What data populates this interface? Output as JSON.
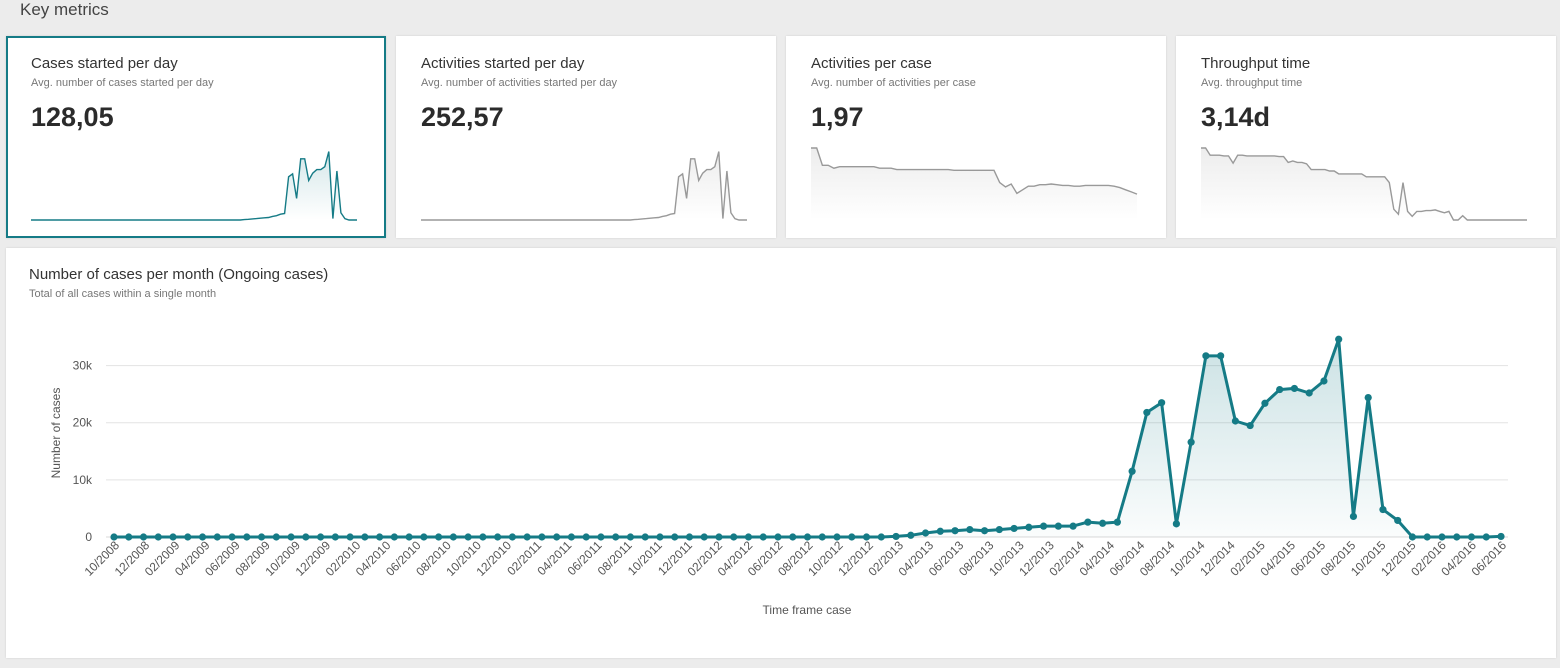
{
  "page": {
    "title": "Key metrics"
  },
  "cards": [
    {
      "title": "Cases started per day",
      "subtitle": "Avg. number of cases started per day",
      "value": "128,05",
      "selected": true,
      "color": "#157b86"
    },
    {
      "title": "Activities started per day",
      "subtitle": "Avg. number of activities started per day",
      "value": "252,57",
      "selected": false,
      "color": "#999999"
    },
    {
      "title": "Activities per case",
      "subtitle": "Avg. number of activities per case",
      "value": "1,97",
      "selected": false,
      "color": "#999999"
    },
    {
      "title": "Throughput time",
      "subtitle": "Avg. throughput time",
      "value": "3,14d",
      "selected": false,
      "color": "#999999"
    }
  ],
  "sparklines": [
    [
      0,
      0,
      0,
      0,
      0,
      0,
      0,
      0,
      0,
      0,
      0,
      0,
      0,
      0,
      0,
      0,
      0,
      0,
      0,
      0,
      0,
      0,
      0,
      0,
      0,
      0,
      0,
      0,
      0,
      0,
      0,
      0,
      0,
      0,
      0,
      0,
      0,
      0,
      0,
      0,
      0,
      0,
      0,
      0,
      0,
      0,
      0,
      0,
      0,
      0,
      0,
      0,
      0,
      0.5,
      1,
      1.5,
      2,
      2.5,
      3,
      3.5,
      5,
      6,
      8,
      9,
      60,
      64,
      30,
      85,
      85,
      55,
      65,
      70,
      70,
      74,
      95,
      2,
      68,
      10,
      2,
      0,
      0,
      0
    ],
    [
      0,
      0,
      0,
      0,
      0,
      0,
      0,
      0,
      0,
      0,
      0,
      0,
      0,
      0,
      0,
      0,
      0,
      0,
      0,
      0,
      0,
      0,
      0,
      0,
      0,
      0,
      0,
      0,
      0,
      0,
      0,
      0,
      0,
      0,
      0,
      0,
      0,
      0,
      0,
      0,
      0,
      0,
      0,
      0,
      0,
      0,
      0,
      0,
      0,
      0,
      0,
      0,
      0,
      0.5,
      1,
      1.5,
      2,
      2.5,
      3,
      3.5,
      5,
      6,
      8,
      9,
      60,
      64,
      30,
      85,
      85,
      55,
      65,
      70,
      70,
      74,
      95,
      2,
      68,
      10,
      2,
      0,
      0,
      0
    ],
    [
      100,
      100,
      76,
      76,
      72,
      74,
      74,
      74,
      74,
      74,
      74,
      74,
      72,
      72,
      72,
      70,
      70,
      70,
      70,
      70,
      70,
      70,
      70,
      70,
      70,
      69,
      69,
      69,
      69,
      69,
      69,
      69,
      69,
      52,
      46,
      50,
      37,
      42,
      47,
      47,
      49,
      49,
      50,
      49,
      48,
      48,
      47,
      47,
      48,
      48,
      48,
      48,
      48,
      47,
      45,
      42,
      39,
      36
    ],
    [
      100,
      100,
      90,
      90,
      90,
      89,
      89,
      79,
      90,
      90,
      89,
      89,
      89,
      89,
      89,
      89,
      89,
      88,
      88,
      80,
      82,
      80,
      80,
      78,
      70,
      70,
      70,
      70,
      68,
      68,
      64,
      64,
      64,
      64,
      64,
      64,
      60,
      60,
      60,
      60,
      60,
      52,
      15,
      8,
      52,
      12,
      5,
      12,
      12,
      13,
      13,
      14,
      12,
      10,
      12,
      0,
      0,
      6,
      0,
      0,
      0,
      0,
      0,
      0,
      0,
      0,
      0,
      0,
      0,
      0,
      0,
      0
    ]
  ],
  "chart": {
    "title": "Number of cases per month (Ongoing cases)",
    "subtitle": "Total of all cases within a single month",
    "color": "#157b86"
  },
  "chart_data": {
    "type": "line",
    "xlabel": "Time frame case",
    "ylabel": "Number of cases",
    "ylim": [
      0,
      35000
    ],
    "y_ticks": [
      0,
      10000,
      20000,
      30000
    ],
    "y_tick_labels": [
      "0",
      "10k",
      "20k",
      "30k"
    ],
    "x_tick_labels": [
      "10/2008",
      "12/2008",
      "02/2009",
      "04/2009",
      "06/2009",
      "08/2009",
      "10/2009",
      "12/2009",
      "02/2010",
      "04/2010",
      "06/2010",
      "08/2010",
      "10/2010",
      "12/2010",
      "02/2011",
      "04/2011",
      "06/2011",
      "08/2011",
      "10/2011",
      "12/2011",
      "02/2012",
      "04/2012",
      "06/2012",
      "08/2012",
      "10/2012",
      "12/2012",
      "02/2013",
      "04/2013",
      "06/2013",
      "08/2013",
      "10/2013",
      "12/2013",
      "02/2014",
      "04/2014",
      "06/2014",
      "08/2014",
      "10/2014",
      "12/2014",
      "02/2015",
      "04/2015",
      "06/2015",
      "08/2015",
      "10/2015",
      "12/2015",
      "02/2016",
      "04/2016",
      "06/2016"
    ],
    "grid": true,
    "x": [
      "10/2008",
      "11/2008",
      "12/2008",
      "01/2009",
      "02/2009",
      "03/2009",
      "04/2009",
      "05/2009",
      "06/2009",
      "07/2009",
      "08/2009",
      "09/2009",
      "10/2009",
      "11/2009",
      "12/2009",
      "01/2010",
      "02/2010",
      "03/2010",
      "04/2010",
      "05/2010",
      "06/2010",
      "07/2010",
      "08/2010",
      "09/2010",
      "10/2010",
      "11/2010",
      "12/2010",
      "01/2011",
      "02/2011",
      "03/2011",
      "04/2011",
      "05/2011",
      "06/2011",
      "07/2011",
      "08/2011",
      "09/2011",
      "10/2011",
      "11/2011",
      "12/2011",
      "01/2012",
      "02/2012",
      "03/2012",
      "04/2012",
      "05/2012",
      "06/2012",
      "07/2012",
      "08/2012",
      "09/2012",
      "10/2012",
      "11/2012",
      "12/2012",
      "01/2013",
      "02/2013",
      "03/2013",
      "04/2013",
      "05/2013",
      "06/2013",
      "07/2013",
      "08/2013",
      "09/2013",
      "10/2013",
      "11/2013",
      "12/2013",
      "01/2014",
      "02/2014",
      "03/2014",
      "04/2014",
      "05/2014",
      "06/2014",
      "07/2014",
      "08/2014",
      "09/2014",
      "10/2014",
      "11/2014",
      "12/2014",
      "01/2015",
      "02/2015",
      "03/2015",
      "04/2015",
      "05/2015",
      "06/2015",
      "07/2015",
      "08/2015",
      "09/2015",
      "10/2015",
      "11/2015",
      "12/2015",
      "01/2016",
      "02/2016",
      "03/2016",
      "04/2016",
      "05/2016",
      "06/2016"
    ],
    "series": [
      {
        "values": [
          0,
          0,
          0,
          0,
          0,
          0,
          0,
          0,
          0,
          0,
          0,
          0,
          0,
          0,
          0,
          0,
          0,
          0,
          0,
          0,
          0,
          0,
          0,
          0,
          0,
          0,
          0,
          0,
          0,
          0,
          0,
          0,
          0,
          0,
          0,
          0,
          0,
          0,
          0,
          0,
          0,
          0,
          0,
          0,
          0,
          0,
          0,
          0,
          0,
          0,
          0,
          0,
          0,
          100,
          300,
          700,
          1000,
          1100,
          1300,
          1100,
          1300,
          1500,
          1700,
          1900,
          1900,
          1900,
          2600,
          2400,
          2600,
          11500,
          21800,
          23500,
          2300,
          16600,
          31700,
          31700,
          20300,
          19500,
          23400,
          25800,
          26000,
          25200,
          27300,
          34600,
          3600,
          24400,
          4800,
          2900,
          0,
          0,
          0,
          0,
          0,
          0,
          100
        ]
      }
    ]
  }
}
